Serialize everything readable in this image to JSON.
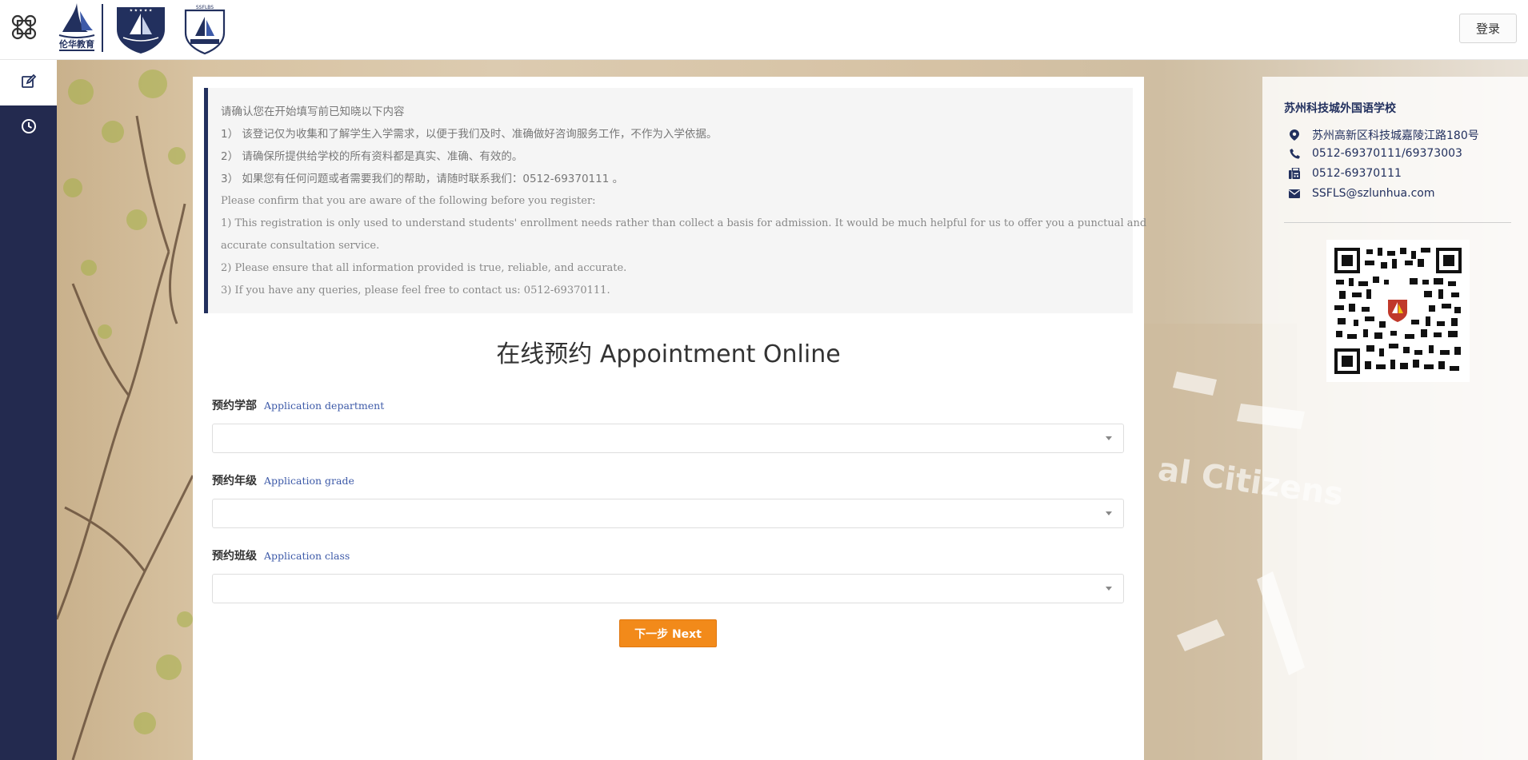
{
  "header": {
    "login_label": "登录",
    "logo1_text": "伦华教育",
    "logo3_text": "SSFLBS"
  },
  "sidebar": {
    "items": [
      {
        "icon": "edit-icon",
        "active": true
      },
      {
        "icon": "clock-icon",
        "active": false
      }
    ]
  },
  "notice": {
    "lines_zh": [
      "请确认您在开始填写前已知晓以下内容",
      "1）  该登记仅为收集和了解学生入学需求，以便于我们及时、准确做好咨询服务工作，不作为入学依据。",
      "2）  请确保所提供给学校的所有资料都是真实、准确、有效的。",
      "3）  如果您有任何问题或者需要我们的帮助，请随时联系我们：0512-69370111 。"
    ],
    "lines_en": [
      "Please confirm that you are aware of the following before you register:",
      "1) This registration is only used to understand students' enrollment needs rather than collect a basis for admission. It would be much helpful for us to offer you a punctual and",
      "accurate consultation service.",
      "2) Please ensure that all information provided is true, reliable, and accurate.",
      "3) If you have any queries, please feel free to contact us: 0512-69370111."
    ]
  },
  "form": {
    "title": "在线预约 Appointment Online",
    "fields": [
      {
        "label_zh": "预约学部",
        "label_en": "Application department",
        "value": ""
      },
      {
        "label_zh": "预约年级",
        "label_en": "Application grade",
        "value": ""
      },
      {
        "label_zh": "预约班级",
        "label_en": "Application class",
        "value": ""
      }
    ],
    "next_label": "下一步 Next"
  },
  "contact": {
    "school_name": "苏州科技城外国语学校",
    "address": "苏州高新区科技城嘉陵江路180号",
    "phone": "0512-69370111/69373003",
    "fax": "0512-69370111",
    "email": "SSFLS@szlunhua.com"
  },
  "background": {
    "wall_text": "al Citizens"
  },
  "colors": {
    "navy": "#22305e",
    "sidebar": "#232a4f",
    "accent_orange": "#f28a1a",
    "label_blue": "#3d5aa8"
  }
}
